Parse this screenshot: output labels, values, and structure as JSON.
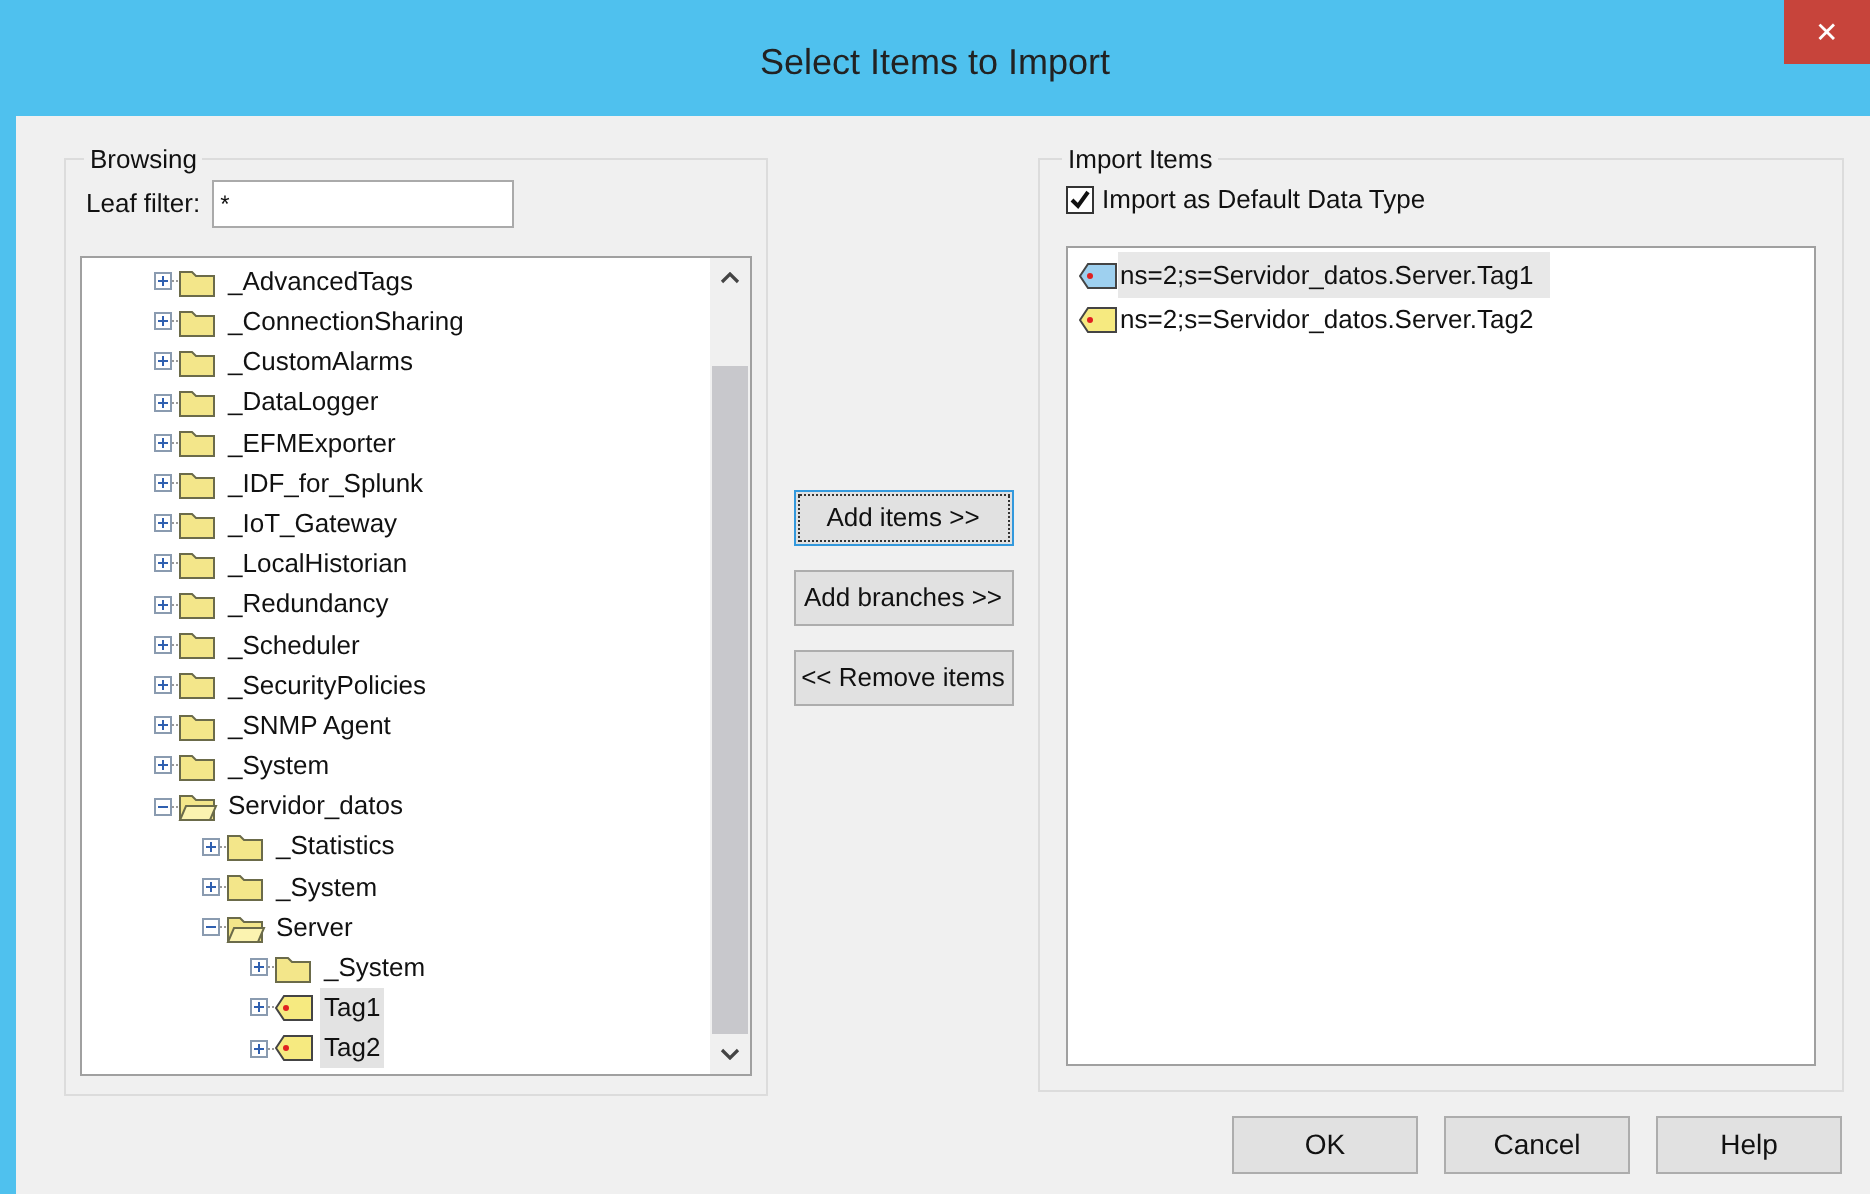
{
  "window": {
    "title": "Select Items to Import",
    "close": "✕"
  },
  "browsing": {
    "label": "Browsing",
    "filter_label": "Leaf filter:",
    "filter_value": "*",
    "tree": [
      {
        "label": "_AdvancedTags",
        "kind": "folder",
        "expanded": false,
        "selected": false
      },
      {
        "label": "_ConnectionSharing",
        "kind": "folder",
        "expanded": false,
        "selected": false
      },
      {
        "label": "_CustomAlarms",
        "kind": "folder",
        "expanded": false,
        "selected": false
      },
      {
        "label": "_DataLogger",
        "kind": "folder",
        "expanded": false,
        "selected": false
      },
      {
        "label": "_EFMExporter",
        "kind": "folder",
        "expanded": false,
        "selected": false
      },
      {
        "label": "_IDF_for_Splunk",
        "kind": "folder",
        "expanded": false,
        "selected": false
      },
      {
        "label": "_IoT_Gateway",
        "kind": "folder",
        "expanded": false,
        "selected": false
      },
      {
        "label": "_LocalHistorian",
        "kind": "folder",
        "expanded": false,
        "selected": false
      },
      {
        "label": "_Redundancy",
        "kind": "folder",
        "expanded": false,
        "selected": false
      },
      {
        "label": "_Scheduler",
        "kind": "folder",
        "expanded": false,
        "selected": false
      },
      {
        "label": "_SecurityPolicies",
        "kind": "folder",
        "expanded": false,
        "selected": false
      },
      {
        "label": "_SNMP Agent",
        "kind": "folder",
        "expanded": false,
        "selected": false
      },
      {
        "label": "_System",
        "kind": "folder",
        "expanded": false,
        "selected": false
      },
      {
        "label": "Servidor_datos",
        "kind": "folder",
        "expanded": true,
        "selected": false,
        "children": [
          {
            "label": "_Statistics",
            "kind": "folder",
            "expanded": false,
            "selected": false
          },
          {
            "label": "_System",
            "kind": "folder",
            "expanded": false,
            "selected": false
          },
          {
            "label": "Server",
            "kind": "folder",
            "expanded": true,
            "selected": false,
            "children": [
              {
                "label": "_System",
                "kind": "folder",
                "expanded": false,
                "selected": false
              },
              {
                "label": "Tag1",
                "kind": "tag",
                "expanded": false,
                "selected": true
              },
              {
                "label": "Tag2",
                "kind": "tag",
                "expanded": false,
                "selected": true
              }
            ]
          }
        ]
      }
    ]
  },
  "middle_buttons": [
    {
      "label": "Add items >>",
      "focused": true
    },
    {
      "label": "Add branches >>",
      "focused": false
    },
    {
      "label": "<< Remove items",
      "focused": false
    }
  ],
  "import": {
    "label": "Import Items",
    "checkbox": {
      "label": "Import as Default Data Type",
      "checked": true
    },
    "items": [
      {
        "label": "ns=2;s=Servidor_datos.Server.Tag1",
        "selected": true
      },
      {
        "label": "ns=2;s=Servidor_datos.Server.Tag2",
        "selected": false
      }
    ]
  },
  "buttons": [
    "OK",
    "Cancel",
    "Help"
  ]
}
